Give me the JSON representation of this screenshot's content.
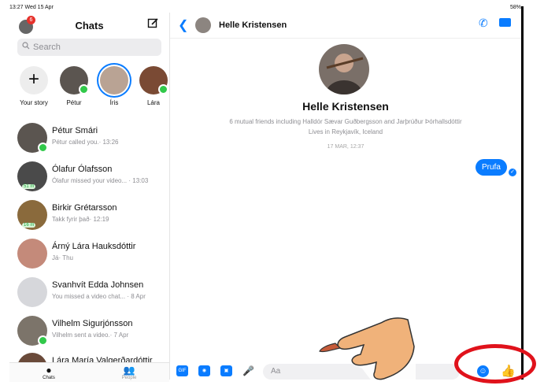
{
  "status": {
    "time": "13:27  Wed 15 Apr",
    "battery": "58%"
  },
  "sidebar": {
    "badge": "6",
    "title": "Chats",
    "search_placeholder": "Search",
    "stories": [
      {
        "label": "Your story"
      },
      {
        "label": "Pétur"
      },
      {
        "label": "Íris"
      },
      {
        "label": "Lára"
      }
    ],
    "chats": [
      {
        "name": "Pétur Smári",
        "preview": "Pétur called you.· 13:26"
      },
      {
        "name": "Ólafur Ólafsson",
        "preview": "Ólafur missed your video... · 13:03",
        "mins": "51 m"
      },
      {
        "name": "Birkir Grétarsson",
        "preview": "Takk fyrir það· 12:19",
        "mins": "16 m"
      },
      {
        "name": "Árný Lára Hauksdóttir",
        "preview": "Já· Thu"
      },
      {
        "name": "Svanhvít Edda Johnsen",
        "preview": "You missed a video chat... · 8 Apr"
      },
      {
        "name": "Vilhelm Sigurjónsson",
        "preview": "Vilhelm sent a video.· 7 Apr"
      },
      {
        "name": "Lára María Valgerðardóttir",
        "preview": ""
      }
    ],
    "tabs": [
      {
        "label": "Chats"
      },
      {
        "label": "People"
      }
    ]
  },
  "conversation": {
    "contact_name": "Helle Kristensen",
    "profile_name": "Helle Kristensen",
    "mutual": "6 mutual friends including Halldór Sævar Guðbergsson and Jarþrúður Þórhallsdóttir",
    "location": "Lives in Reykjavík, Iceland",
    "timestamp": "17 MAR, 12:37",
    "message": "Prufa",
    "composer_placeholder": "Aa",
    "gif_label": "GIF"
  },
  "colors": {
    "accent": "#0a7cff",
    "annotation_ring": "#e0121b"
  }
}
